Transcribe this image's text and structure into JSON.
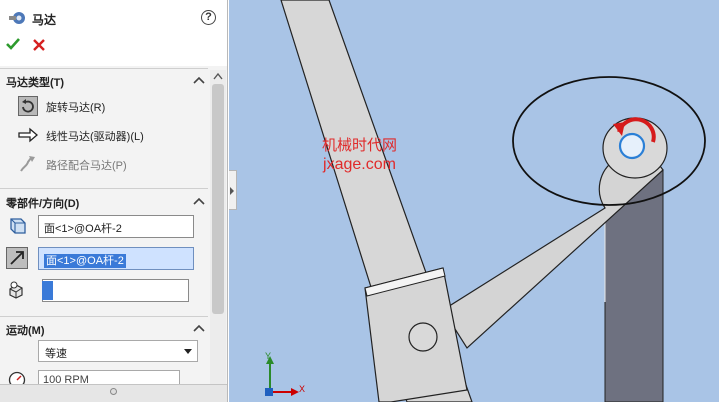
{
  "panel": {
    "title": "马达",
    "help": "?",
    "sections": {
      "motor_type": {
        "title": "马达类型(T)",
        "options": [
          {
            "label": "旋转马达(R)",
            "icon": "rotary-motor-icon",
            "selected": true
          },
          {
            "label": "线性马达(驱动器)(L)",
            "icon": "linear-motor-icon",
            "selected": false
          },
          {
            "label": "路径配合马达(P)",
            "icon": "path-mate-motor-icon",
            "selected": false,
            "disabled": true
          }
        ]
      },
      "component_direction": {
        "title": "零部件/方向(D)",
        "motor_location": "面<1>@OA杆-2",
        "motor_direction": "面<1>@OA杆-2",
        "component_to_move": ""
      },
      "motion": {
        "title": "运动(M)",
        "motion_type": "等速",
        "speed": "100 RPM"
      }
    }
  },
  "viewport": {
    "watermark_line1": "机械时代网",
    "watermark_line2": "jxage.com",
    "axis_x": "X",
    "axis_y": "Y"
  },
  "colors": {
    "viewport_bg": "#a9c4e6",
    "link_face": "#d8d8d8",
    "link_side": "#6f7280",
    "accent_red": "#e02a2a",
    "selection_blue": "#3a7ad8"
  }
}
